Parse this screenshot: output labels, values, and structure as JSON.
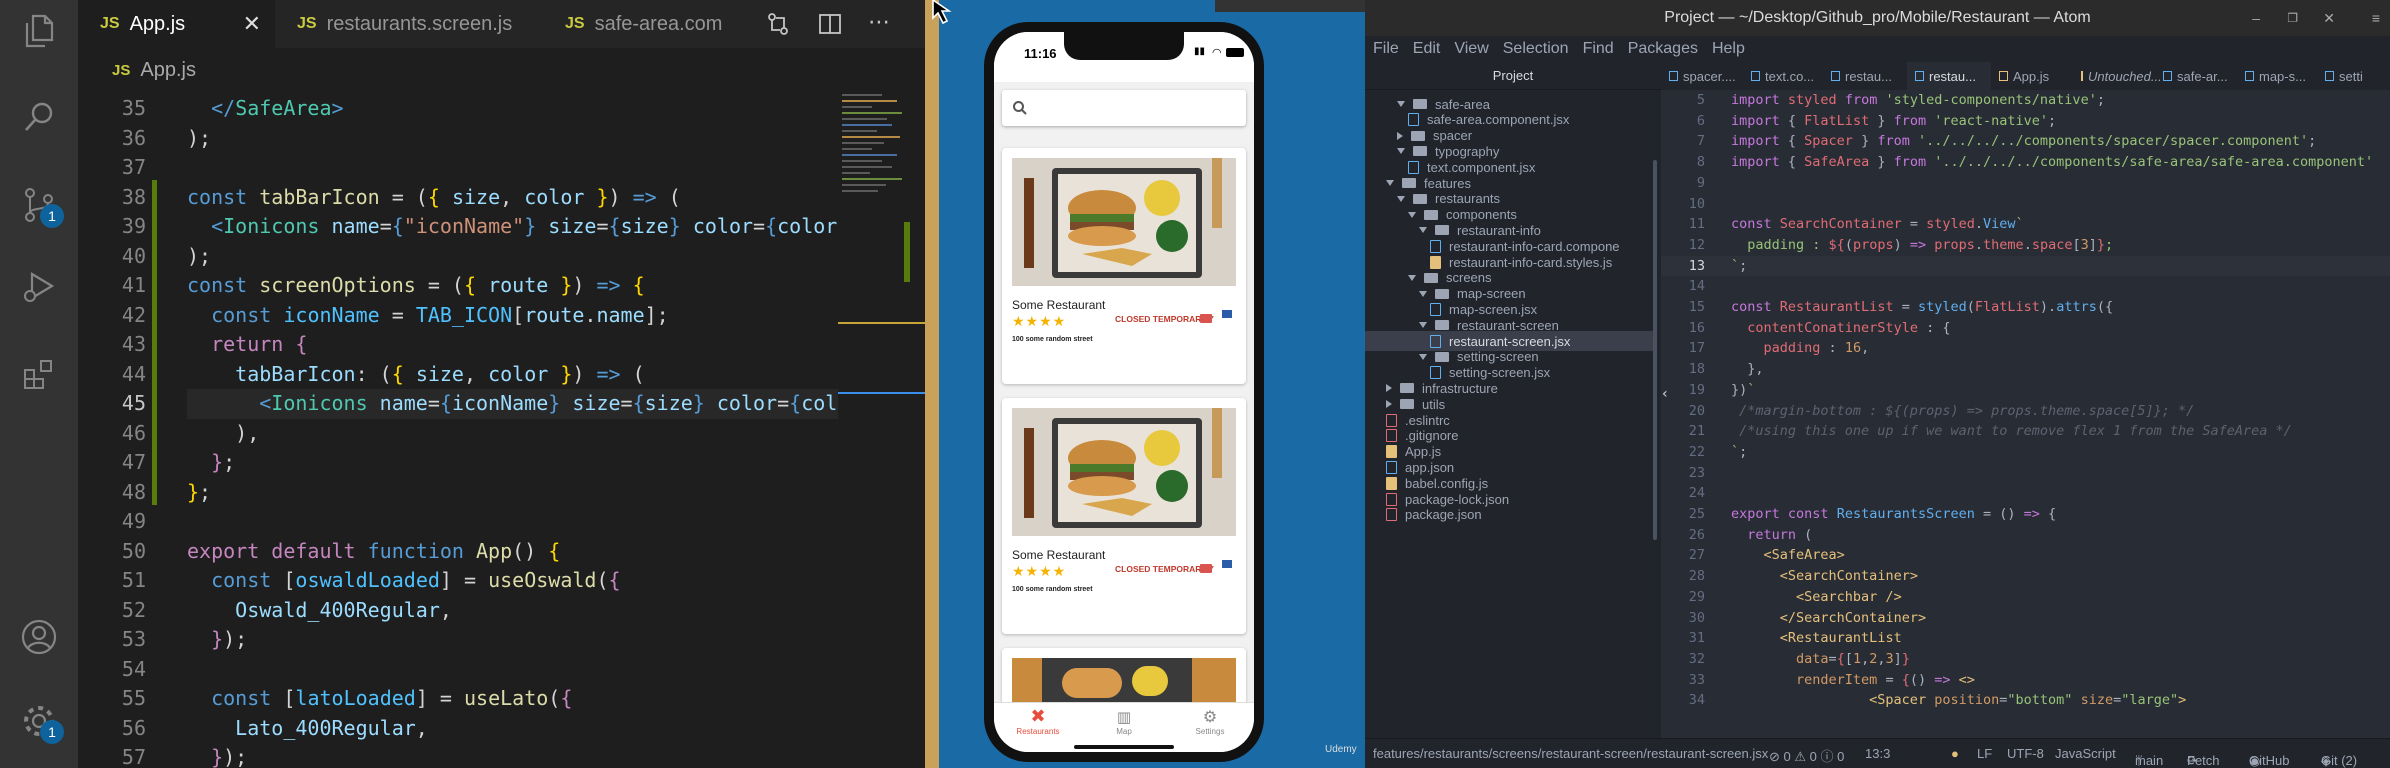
{
  "vscode": {
    "tabs": [
      {
        "icon": "JS",
        "label": "App.js"
      },
      {
        "icon": "JS",
        "label": "restaurants.screen.js"
      },
      {
        "icon": "JS",
        "label": "safe-area.com"
      }
    ],
    "breadcrumb": {
      "icon": "JS",
      "label": "App.js"
    },
    "scm_badge": "1",
    "settings_badge": "1",
    "line_numbers": [
      "35",
      "36",
      "37",
      "38",
      "39",
      "40",
      "41",
      "42",
      "43",
      "44",
      "45",
      "46",
      "47",
      "48",
      "49",
      "50",
      "51",
      "52",
      "53",
      "54",
      "55",
      "56",
      "57"
    ]
  },
  "phone": {
    "time": "11:16",
    "cards": [
      {
        "name": "Some Restaurant",
        "address": "100 some random street",
        "status": "CLOSED TEMPORARILY"
      },
      {
        "name": "Some Restaurant",
        "address": "100 some random street",
        "status": "CLOSED TEMPORARILY"
      }
    ],
    "tabs": [
      {
        "label": "Restaurants"
      },
      {
        "label": "Map"
      },
      {
        "label": "Settings"
      }
    ],
    "watermark": "Udemy"
  },
  "atom": {
    "title": "Project — ~/Desktop/Github_pro/Mobile/Restaurant — Atom",
    "menu": [
      "File",
      "Edit",
      "View",
      "Selection",
      "Find",
      "Packages",
      "Help"
    ],
    "tree_header": "Project",
    "tree": [
      {
        "label": "safe-area",
        "type": "folder-open"
      },
      {
        "label": "safe-area.component.jsx",
        "type": "file"
      },
      {
        "label": "spacer",
        "type": "folder-closed"
      },
      {
        "label": "typography",
        "type": "folder-open"
      },
      {
        "label": "text.component.jsx",
        "type": "file"
      },
      {
        "label": "features",
        "type": "folder-open"
      },
      {
        "label": "restaurants",
        "type": "folder-open"
      },
      {
        "label": "components",
        "type": "folder-open"
      },
      {
        "label": "restaurant-info",
        "type": "folder-open"
      },
      {
        "label": "restaurant-info-card.compone",
        "type": "file"
      },
      {
        "label": "restaurant-info-card.styles.js",
        "type": "js"
      },
      {
        "label": "screens",
        "type": "folder-open"
      },
      {
        "label": "map-screen",
        "type": "folder-open"
      },
      {
        "label": "map-screen.jsx",
        "type": "file"
      },
      {
        "label": "restaurant-screen",
        "type": "folder-open"
      },
      {
        "label": "restaurant-screen.jsx",
        "type": "file"
      },
      {
        "label": "setting-screen",
        "type": "folder-open"
      },
      {
        "label": "setting-screen.jsx",
        "type": "file"
      },
      {
        "label": "infrastructure",
        "type": "folder-closed"
      },
      {
        "label": "utils",
        "type": "folder-closed"
      },
      {
        "label": ".eslintrc",
        "type": "dot"
      },
      {
        "label": ".gitignore",
        "type": "git"
      },
      {
        "label": "App.js",
        "type": "js"
      },
      {
        "label": "app.json",
        "type": "json"
      },
      {
        "label": "babel.config.js",
        "type": "js"
      },
      {
        "label": "package-lock.json",
        "type": "npm"
      },
      {
        "label": "package.json",
        "type": "npm"
      }
    ],
    "tabs": [
      "spacer....",
      "text.co...",
      "restau...",
      "restau...",
      "App.js",
      "Untouched...",
      "safe-ar...",
      "map-s...",
      "setti"
    ],
    "line_numbers": [
      "5",
      "6",
      "7",
      "8",
      "9",
      "10",
      "11",
      "12",
      "13",
      "14",
      "15",
      "16",
      "17",
      "18",
      "19",
      "20",
      "21",
      "22",
      "23",
      "24",
      "25",
      "26",
      "27",
      "28",
      "29",
      "30",
      "31",
      "32",
      "33",
      "34"
    ],
    "status": {
      "path": "features/restaurants/screens/restaurant-screen/restaurant-screen.jsx",
      "diag": "⊘ 0  ⚠ 0  ⓘ 0",
      "pos": "13:3",
      "eol": "LF",
      "enc": "UTF-8",
      "grammar": "JavaScript",
      "branch": "main",
      "fetch": "Fetch",
      "github": "GitHub",
      "git": "Git (2)"
    }
  }
}
